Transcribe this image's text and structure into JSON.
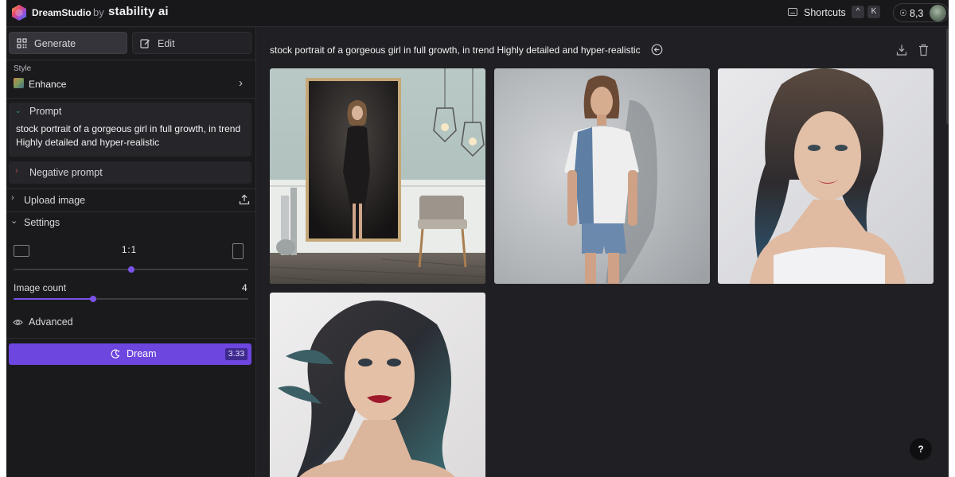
{
  "header": {
    "app_name": "DreamStudio",
    "by": "by",
    "company": "stability ai",
    "shortcuts_label": "Shortcuts",
    "shortcut_keys": [
      "^",
      "K"
    ],
    "credits_value": "8,3"
  },
  "sidebar": {
    "tabs": [
      {
        "label": "Generate",
        "icon": "grid-icon",
        "active": true
      },
      {
        "label": "Edit",
        "icon": "edit-icon",
        "active": false
      }
    ],
    "style": {
      "label": "Style",
      "value": "Enhance"
    },
    "prompt": {
      "title": "Prompt",
      "text": "stock portrait of a gorgeous  girl in full growth, in trend Highly detailed and hyper-realistic"
    },
    "negative_prompt": {
      "title": "Negative prompt"
    },
    "upload_image": {
      "label": "Upload image"
    },
    "settings": {
      "label": "Settings",
      "aspect_ratio": "1:1",
      "aspect_slider_level": 0.5,
      "image_count_label": "Image count",
      "image_count_value": "4",
      "image_count_level": 0.34
    },
    "advanced": {
      "label": "Advanced"
    },
    "dream_button": {
      "label": "Dream",
      "cost": "3.33"
    }
  },
  "main": {
    "prompt_title": "stock portrait of a gorgeous girl in full growth, in trend Highly detailed and hyper-realistic",
    "images": [
      {
        "subject": "woman in black dress framed portrait in room with pendant lamps"
      },
      {
        "subject": "young woman in white top and denim shorts against grey wall"
      },
      {
        "subject": "illustrated woman with long dark wavy hair in white top"
      },
      {
        "subject": "illustrated woman with windswept dark teal hair"
      }
    ],
    "help_label": "?"
  },
  "colors": {
    "accent": "#6d45df",
    "background": "#202024",
    "sidebar": "#1a1a1d"
  }
}
